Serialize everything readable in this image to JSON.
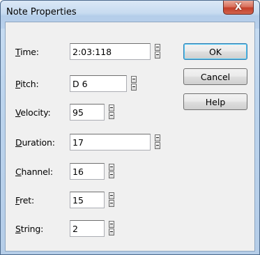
{
  "window": {
    "title": "Note Properties",
    "close_glyph": "X"
  },
  "fields": [
    {
      "key": "time",
      "mnemonic": "T",
      "rest": "ime:",
      "value": "2:03:118"
    },
    {
      "key": "pitch",
      "mnemonic": "P",
      "rest": "itch:",
      "value": "D 6"
    },
    {
      "key": "velocity",
      "mnemonic": "V",
      "rest": "elocity:",
      "value": "95"
    },
    {
      "key": "duration",
      "mnemonic": "D",
      "rest": "uration:",
      "value": "17"
    },
    {
      "key": "channel",
      "mnemonic": "C",
      "rest": "hannel:",
      "value": "16"
    },
    {
      "key": "fret",
      "mnemonic": "F",
      "rest": "ret:",
      "value": "15"
    },
    {
      "key": "string",
      "mnemonic": "S",
      "rest": "tring:",
      "value": "2"
    }
  ],
  "buttons": {
    "ok": "OK",
    "cancel": "Cancel",
    "help": "Help"
  },
  "colors": {
    "accent_default_button": "#3c7fb1",
    "close_button": "#c4402a",
    "dialog_face": "#f0f0f0"
  }
}
